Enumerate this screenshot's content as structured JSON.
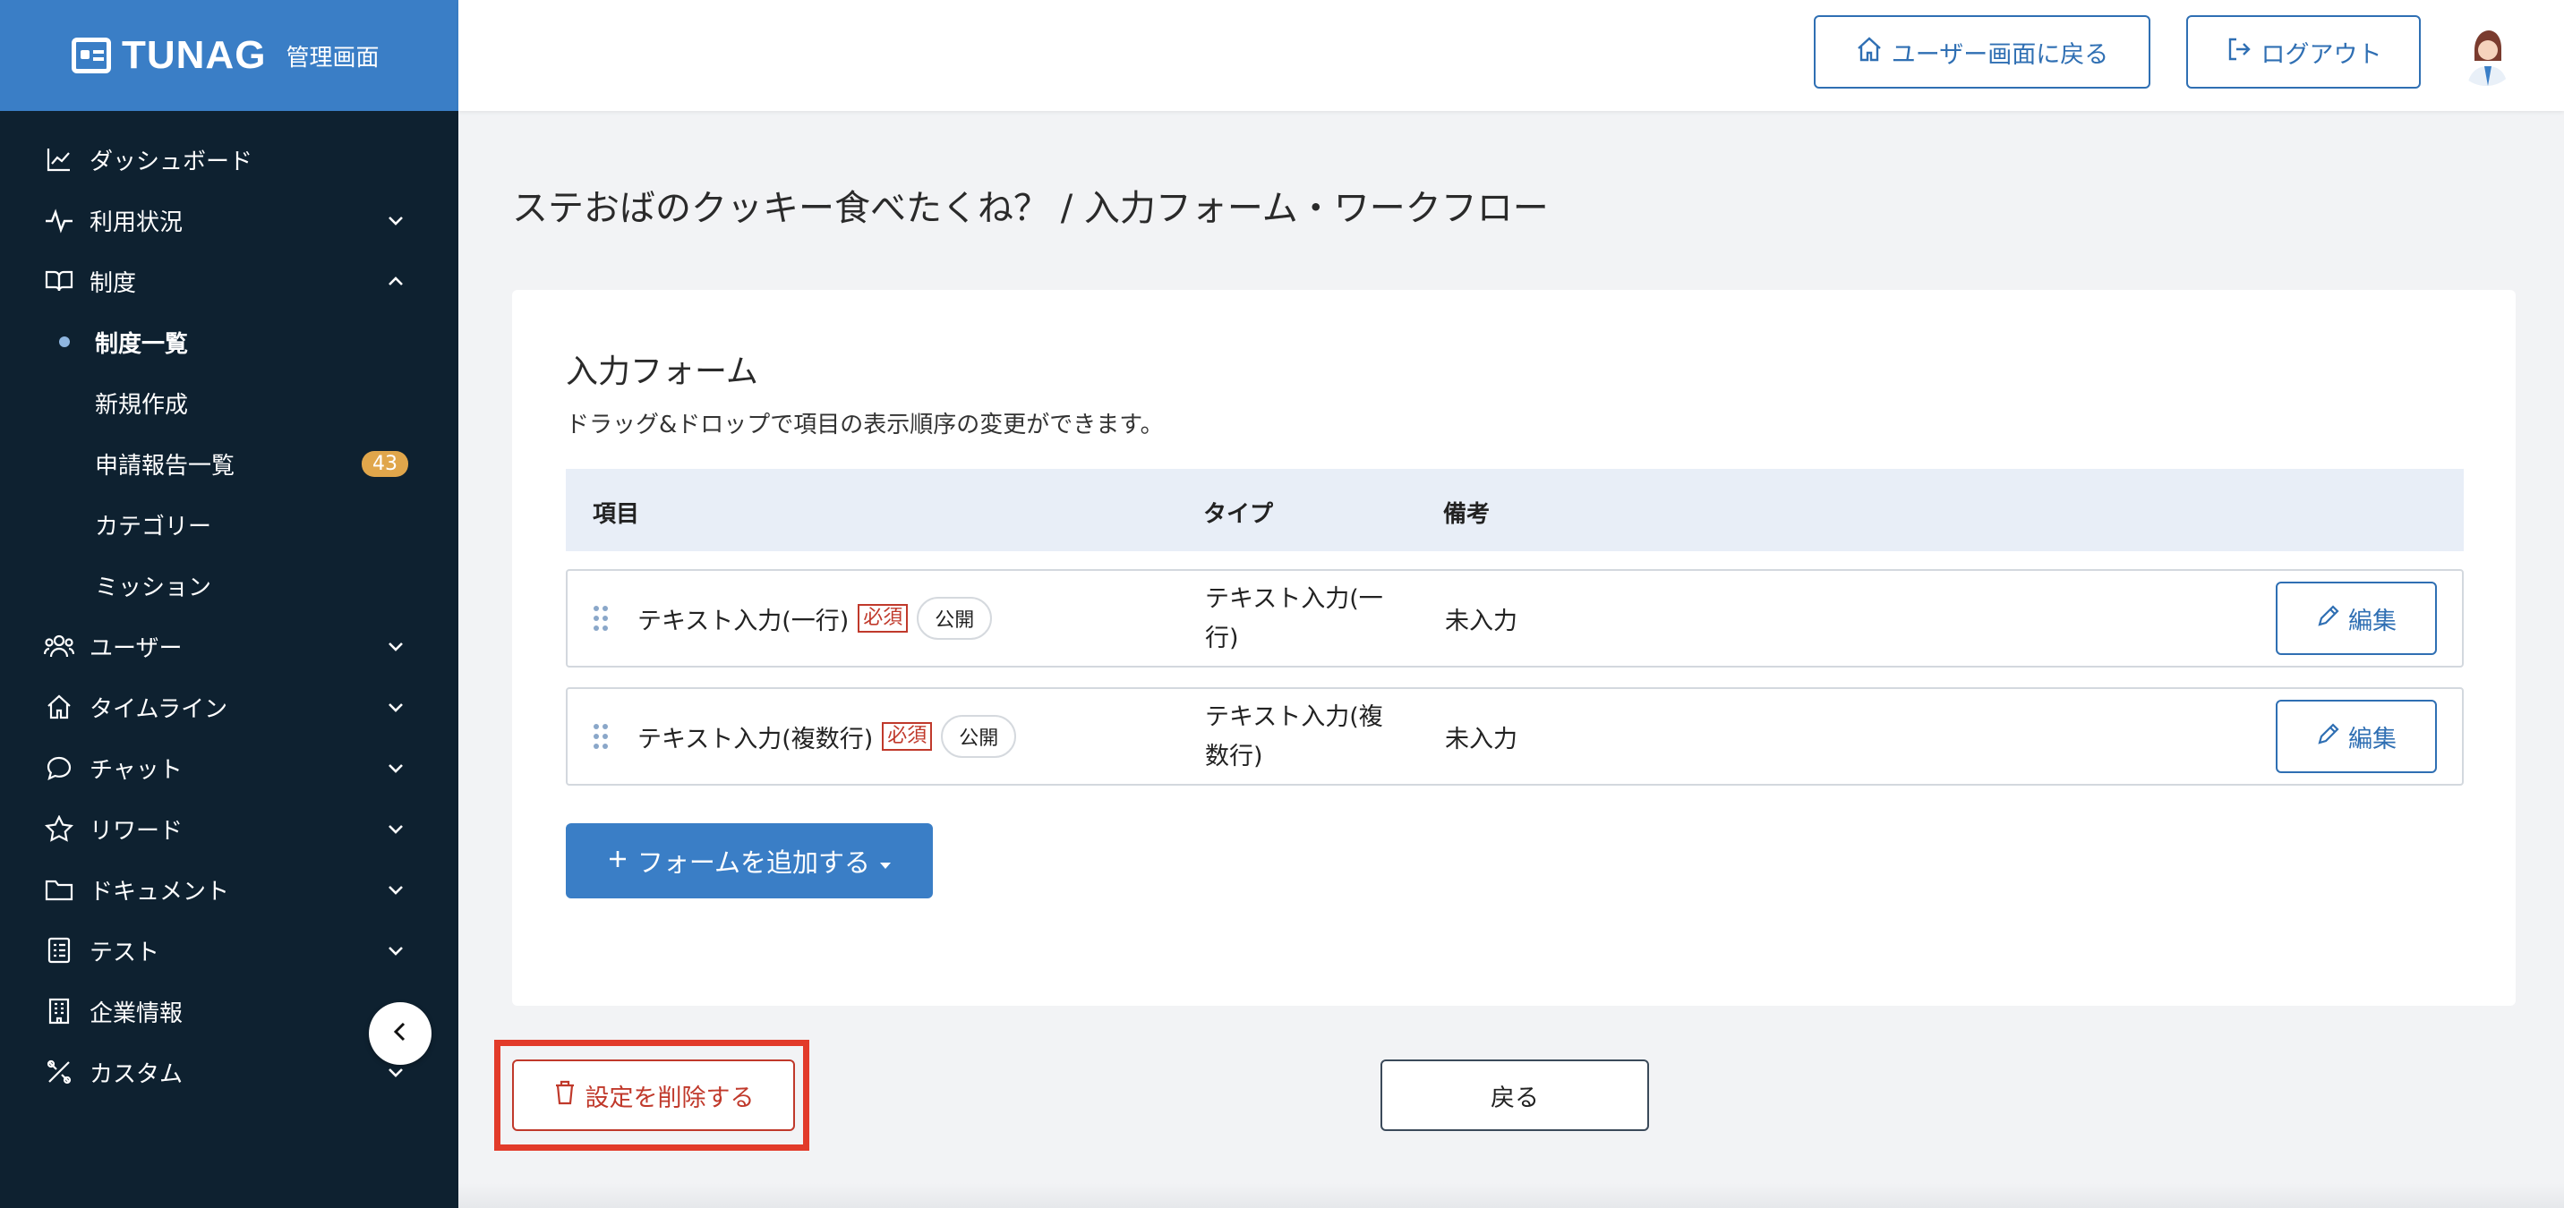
{
  "brand": {
    "name": "TUNAG",
    "subtitle": "管理画面"
  },
  "sidebar": {
    "items": [
      {
        "label": "ダッシュボード",
        "icon": "chart-line-icon"
      },
      {
        "label": "利用状況",
        "icon": "pulse-icon"
      },
      {
        "label": "制度",
        "icon": "book-icon"
      },
      {
        "label": "制度一覧"
      },
      {
        "label": "新規作成"
      },
      {
        "label": "申請報告一覧",
        "badge": "43"
      },
      {
        "label": "カテゴリー"
      },
      {
        "label": "ミッション"
      },
      {
        "label": "ユーザー",
        "icon": "users-icon"
      },
      {
        "label": "タイムライン",
        "icon": "home-icon"
      },
      {
        "label": "チャット",
        "icon": "chat-bubble-icon"
      },
      {
        "label": "リワード",
        "icon": "star-icon"
      },
      {
        "label": "ドキュメント",
        "icon": "folder-icon"
      },
      {
        "label": "テスト",
        "icon": "checklist-icon"
      },
      {
        "label": "企業情報",
        "icon": "building-icon"
      },
      {
        "label": "カスタム",
        "icon": "tools-icon"
      }
    ]
  },
  "header": {
    "user_screen_button": "ユーザー画面に戻る",
    "logout_button": "ログアウト"
  },
  "page": {
    "title": "ステおばのクッキー食べたくね？ / 入力フォーム・ワークフロー"
  },
  "form": {
    "section_title": "入力フォーム",
    "description": "ドラッグ&ドロップで項目の表示順序の変更ができます。",
    "columns": [
      "項目",
      "タイプ",
      "備考"
    ],
    "rows": [
      {
        "name": "テキスト入力(一行)",
        "required_tag": "必須",
        "public_tag": "公開",
        "type_line1": "テキスト入力(一",
        "type_line2": "行)",
        "note": "未入力",
        "edit_label": "編集"
      },
      {
        "name": "テキスト入力(複数行)",
        "required_tag": "必須",
        "public_tag": "公開",
        "type_line1": "テキスト入力(複",
        "type_line2": "数行)",
        "note": "未入力",
        "edit_label": "編集"
      }
    ],
    "add_button": "フォームを追加する"
  },
  "footer": {
    "delete_button": "設定を削除する",
    "back_button": "戻る"
  },
  "colors": {
    "sidebar_bg": "#0e2130",
    "brand_bg": "#3a7ec6",
    "accent": "#2f6fb3",
    "danger": "#c0392b",
    "highlight": "#e23b2a",
    "badge": "#e0a64b"
  }
}
